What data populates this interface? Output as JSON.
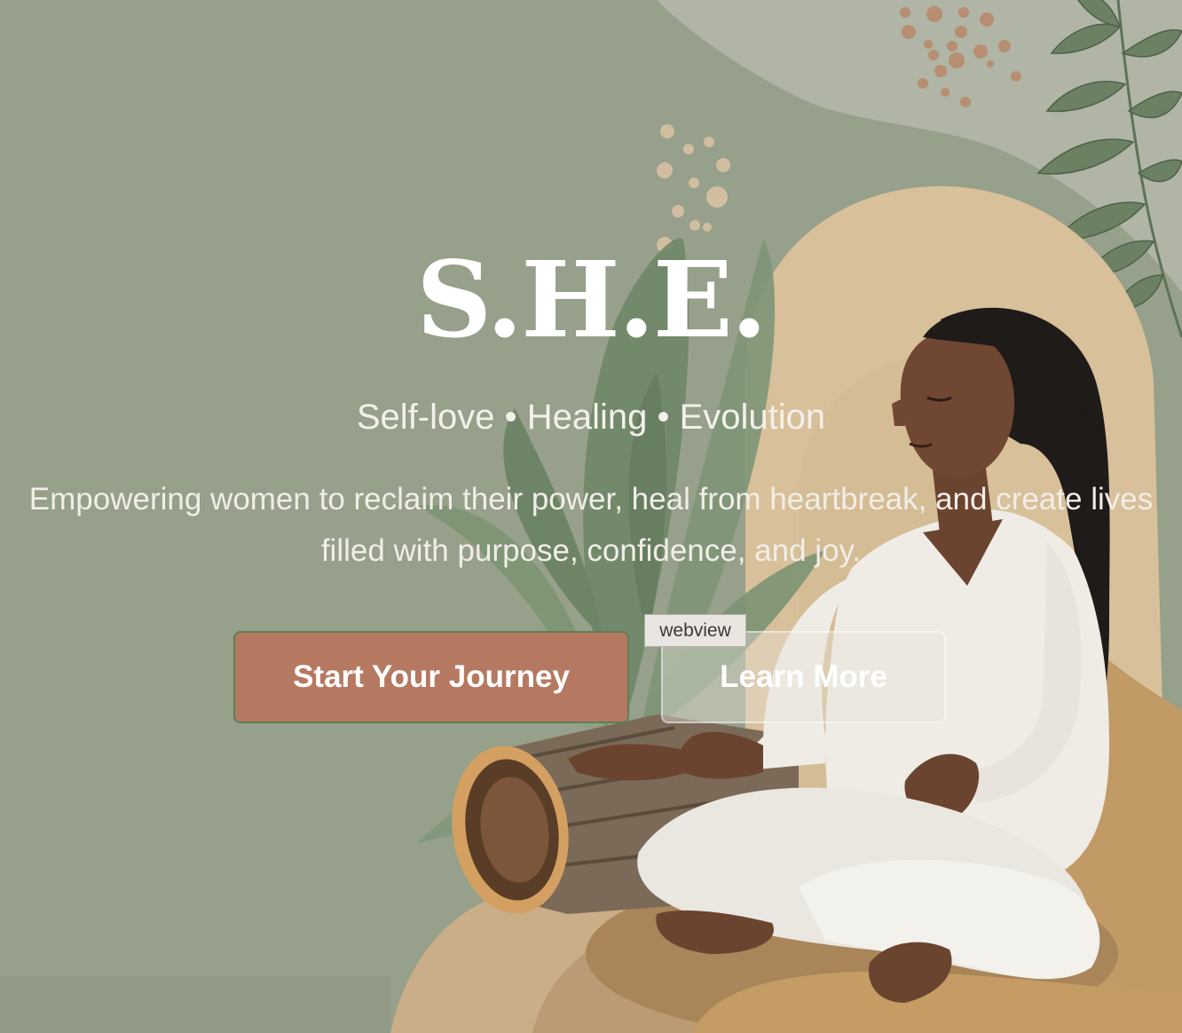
{
  "hero": {
    "brand": "S.H.E.",
    "tagline": "Self-love • Healing • Evolution",
    "description": "Empowering women to reclaim their power, heal from heartbreak, and create lives filled with purpose, confidence, and joy.",
    "primary_button_label": "Start Your Journey",
    "secondary_button_label": "Learn More"
  },
  "overlay": {
    "webview_label": "webview"
  },
  "colors": {
    "background": "#96a08a",
    "primary_button": "#b57962",
    "primary_button_border": "#5f7e56",
    "text": "#ffffff",
    "sand": "#d8c09a",
    "ochre": "#c29a66",
    "leaf": "#6f8566"
  },
  "illustration": {
    "subject": "meditating-woman",
    "elements": [
      "leaf-branch-icon",
      "sage-leaves-icon",
      "bark-log-icon",
      "dots-pattern-icon",
      "sand-arch-shape"
    ]
  }
}
